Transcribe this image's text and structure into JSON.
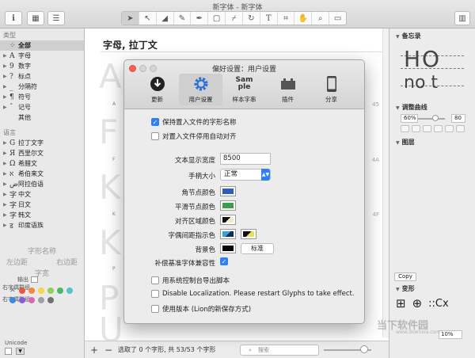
{
  "window": {
    "title": "新字体 - 新字体"
  },
  "sidebar": {
    "category_header": "类型",
    "items": [
      {
        "glyph": "",
        "label": "全部"
      },
      {
        "glyph": "A",
        "label": "字母"
      },
      {
        "glyph": "9",
        "label": "数字"
      },
      {
        "glyph": "?",
        "label": "标点"
      },
      {
        "glyph": "_",
        "label": "分隔符"
      },
      {
        "glyph": "¶",
        "label": "符号"
      },
      {
        "glyph": "ˆ",
        "label": "记号"
      },
      {
        "glyph": "",
        "label": "其他"
      }
    ],
    "language_header": "语言",
    "languages": [
      {
        "glyph": "G",
        "label": "拉丁文字"
      },
      {
        "glyph": "Я",
        "label": "西里尔文"
      },
      {
        "glyph": "Ω",
        "label": "希腊文"
      },
      {
        "glyph": "א",
        "label": "希伯来文"
      },
      {
        "glyph": "ض",
        "label": "阿拉伯语"
      },
      {
        "glyph": "字",
        "label": "中文"
      },
      {
        "glyph": "字",
        "label": "日文"
      },
      {
        "glyph": "字",
        "label": "韩文"
      },
      {
        "glyph": "ड",
        "label": "印度语族"
      }
    ],
    "metrics": {
      "glyph_name": "字形名称",
      "left": "左边距",
      "right": "右边距",
      "width": "字宽"
    },
    "right_kern": "右字偶群组",
    "left_kern": "右字偶群组",
    "output": "输出",
    "unicode": "Unicode",
    "swatch_colors": [
      "#e9573f",
      "#f08a3e",
      "#f7d64a",
      "#8fcf5a",
      "#4ab86a",
      "#54c2c8",
      "#3c8ae0",
      "#8a5cd6",
      "#d46ab0",
      "#a0a0a0",
      "#707070",
      "#404040"
    ]
  },
  "main": {
    "title": "字母, 拉丁文",
    "ghost_rows": [
      {
        "big": "A",
        "letter": "A",
        "hex": "45"
      },
      {
        "big": "F",
        "letter": "F",
        "hex": "4A"
      },
      {
        "big": "K",
        "letter": "K",
        "hex": ""
      },
      {
        "big": "K",
        "letter": "K",
        "hex": "4F"
      },
      {
        "big": "P",
        "letter": "P",
        "hex": ""
      },
      {
        "big": "U",
        "letter": "U",
        "hex": ""
      }
    ],
    "status": "选取了 0 个字形, 共 53/53 个字形",
    "search_placeholder": "搜索"
  },
  "right_panel": {
    "memo_header": "备忘录",
    "memo_text_top": "HO",
    "memo_text_bot": "no t",
    "curve_header": "调整曲线",
    "curve_value_left": "60%",
    "curve_value_right": "80",
    "layers_header": "图层",
    "copy_label": "Copy",
    "transform_header": "变形",
    "zoom_value": "10%",
    "watermark": "当下软件园",
    "watermark_url": "www.downxia.com"
  },
  "dialog": {
    "title": "偏好设置：用户设置",
    "tabs": [
      {
        "label": "更新",
        "icon": "download-icon"
      },
      {
        "label": "用户设置",
        "icon": "gear-icon"
      },
      {
        "label": "样本字串",
        "icon": "sample-icon",
        "icon_text_top": "Sam",
        "icon_text_bot": "ple"
      },
      {
        "label": "插件",
        "icon": "plugin-icon"
      },
      {
        "label": "分享",
        "icon": "phone-icon"
      }
    ],
    "keep_names": "保持置入文件的字形名称",
    "auto_align": "对置入文件停用自动对齐",
    "text_width_label": "文本显示宽度",
    "text_width_value": "8500",
    "handle_size_label": "手柄大小",
    "handle_size_value": "正常",
    "corner_color_label": "角节点颜色",
    "smooth_color_label": "平滑节点颜色",
    "align_color_label": "对齐区域颜色",
    "kern_color_label": "字偶间距指示色",
    "bg_color_label": "背景色",
    "standard_button": "标准",
    "compat_label": "补偿基准字体兼容性",
    "export_script": "用系统控制台导出脚本",
    "disable_localization": "Disable Localization. Please restart Glyphs to take effect.",
    "lion_save": "使用版本 (Lion的新保存方式)",
    "colors": {
      "corner": "#2f5fb8",
      "smooth": "#3a9e4e",
      "background": "#000000",
      "accent": "#2f7ff5"
    }
  }
}
